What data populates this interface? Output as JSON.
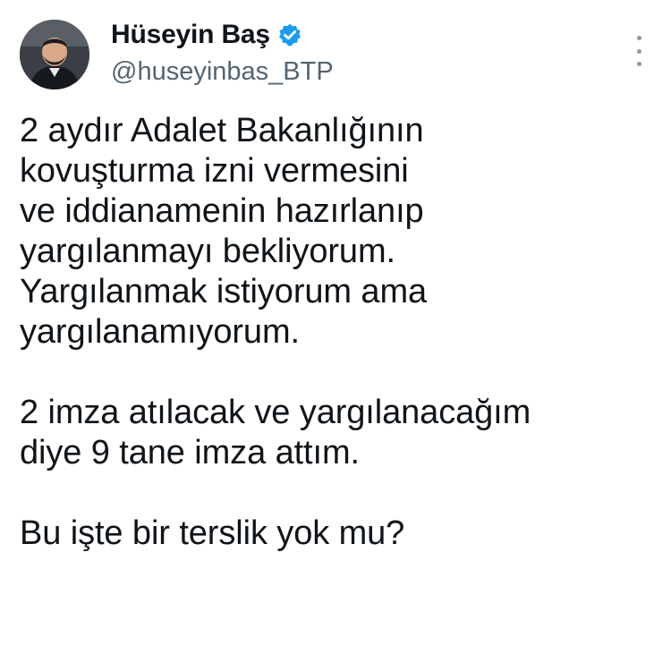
{
  "tweet": {
    "author": {
      "display_name": "Hüseyin Baş",
      "handle": "@huseyinbas_BTP",
      "verified_icon": "verified-badge-icon",
      "badge_color": "#1d9bf0"
    },
    "more_icon": "more-vertical-icon",
    "text_lines": [
      "2 aydır Adalet Bakanlığının",
      "kovuşturma izni vermesini",
      "ve iddianamenin hazırlanıp",
      "yargılanmayı bekliyorum.",
      "Yargılanmak istiyorum ama",
      "yargılanamıyorum.",
      "",
      "2 imza atılacak ve yargılanacağım",
      "diye 9 tane imza attım.",
      "",
      "Bu işte bir terslik yok mu?"
    ]
  }
}
